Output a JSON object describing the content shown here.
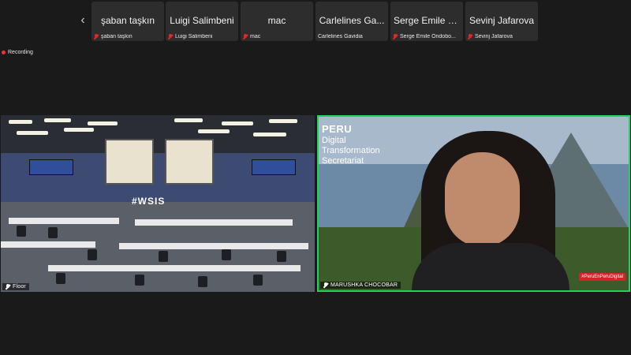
{
  "strip": {
    "participants": [
      {
        "tile_name": "şaban taşkın",
        "label": "şaban taşkın",
        "muted": true
      },
      {
        "tile_name": "Luigi Salimbeni",
        "label": "Luigi Salimbeni",
        "muted": true
      },
      {
        "tile_name": "mac",
        "label": "mac",
        "muted": true
      },
      {
        "tile_name": "Carlelines Ga...",
        "label": "Carlelines Gavidia",
        "muted": false
      },
      {
        "tile_name": "Serge Emile O...",
        "label": "Serge Emile Ondobo...",
        "muted": true
      },
      {
        "tile_name": "Sevinj Jafarova",
        "label": "Sevinj Jafarova",
        "muted": true
      }
    ],
    "prev_icon": "‹"
  },
  "recording": {
    "label": "Recording",
    "color": "#e33333"
  },
  "main": {
    "left": {
      "name": "Floor",
      "backdrop_text": "#WSIS"
    },
    "right": {
      "name": "MARUSHKA CHOCOBAR",
      "background": {
        "title": "PERU",
        "line1": "Digital",
        "line2": "Transformation",
        "line3": "Secretariat",
        "hashtag": "#PeruEnPeruDigital"
      },
      "active_speaker_color": "#23d160"
    }
  }
}
